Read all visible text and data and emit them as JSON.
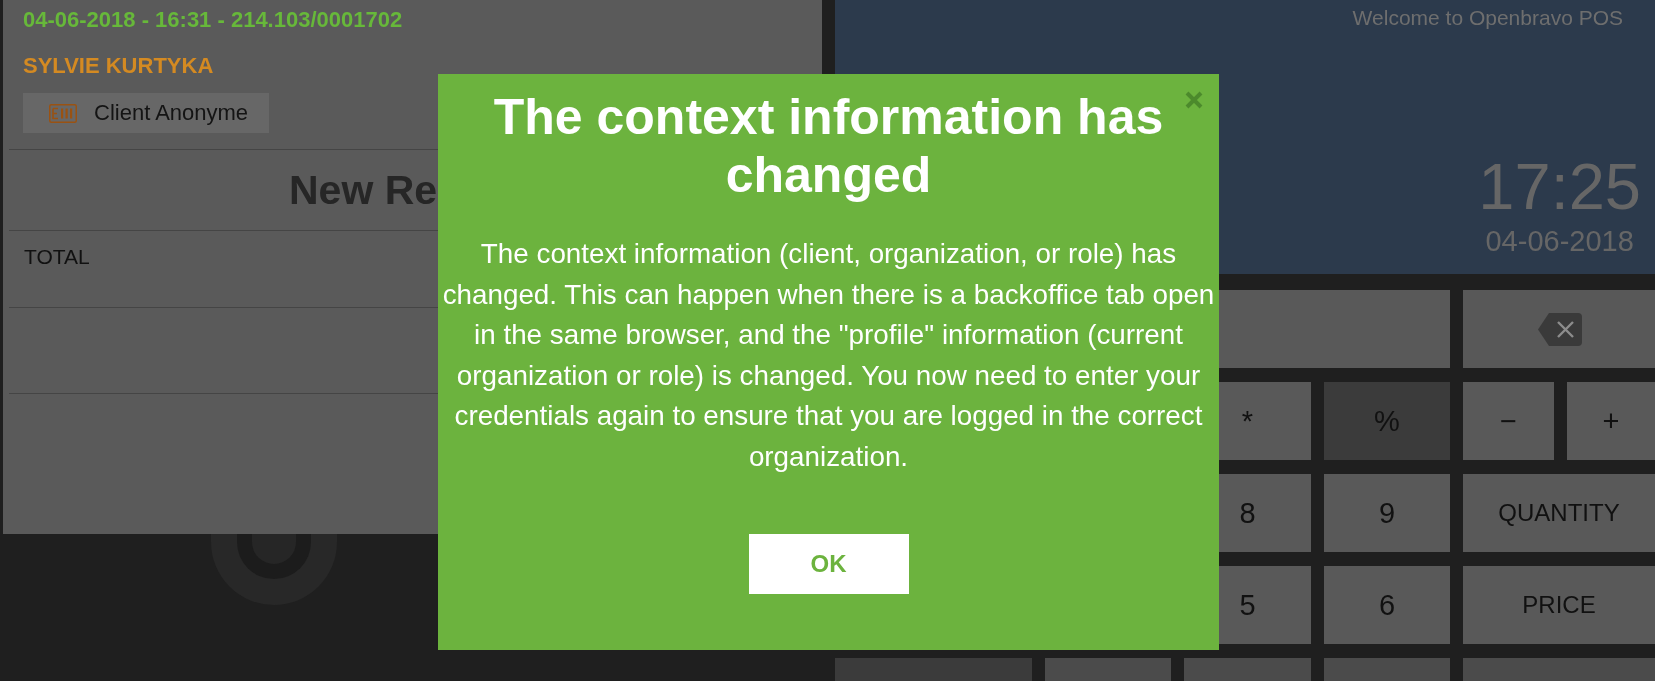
{
  "receipt": {
    "info": "04-06-2018 - 16:31 - 214.103/0001702",
    "salesperson": "SYLVIE KURTYKA",
    "customer_button": "Client Anonyme",
    "title": "New Re",
    "total_label": "TOTAL"
  },
  "header": {
    "welcome": "Welcome to Openbravo POS",
    "time": "17:25",
    "date": "04-06-2018"
  },
  "keypad": {
    "keys": [
      {
        "kind": "key"
      },
      {
        "kind": "erase"
      },
      {
        "kind": "key",
        "label": "*"
      },
      {
        "kind": "dark",
        "label": "%"
      },
      {
        "kind": "key",
        "label": "−"
      },
      {
        "kind": "key",
        "label": "+"
      },
      {
        "kind": "key",
        "label": "8"
      },
      {
        "kind": "key",
        "label": "9"
      },
      {
        "kind": "command",
        "label": "QUANTITY"
      },
      {
        "kind": "key",
        "label": "5"
      },
      {
        "kind": "key",
        "label": "6"
      },
      {
        "kind": "command",
        "label": "PRICE"
      },
      {
        "kind": "dark"
      },
      {
        "kind": "dim"
      },
      {
        "kind": "dim"
      },
      {
        "kind": "dim"
      },
      {
        "kind": "dim"
      }
    ]
  },
  "dialog": {
    "title": "The context information has changed",
    "message": "The context information (client, organization, or role) has changed. This can happen when there is a backoffice tab open in the same browser, and the \"profile\" information (current organization or role) is changed. You now need to enter your credentials again to ensure that you are logged in the correct organization.",
    "button": "OK"
  }
}
